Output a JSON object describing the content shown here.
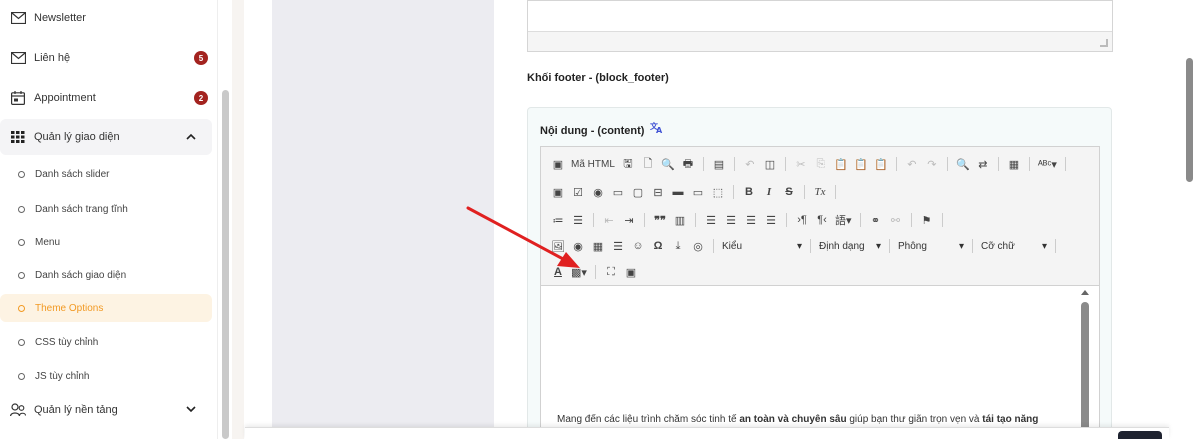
{
  "sidebar": {
    "items": [
      {
        "label": "Newsletter",
        "icon": "mail-icon"
      },
      {
        "label": "Liên hệ",
        "icon": "mail-icon",
        "badge": "5"
      },
      {
        "label": "Appointment",
        "icon": "calendar-icon",
        "badge": "2"
      },
      {
        "label": "Quản lý giao diện",
        "icon": "grid-icon"
      },
      {
        "label": "Quản lý nền tảng",
        "icon": "users-icon"
      }
    ],
    "sub_items": [
      {
        "label": "Danh sách slider"
      },
      {
        "label": "Danh sách trang tĩnh"
      },
      {
        "label": "Menu"
      },
      {
        "label": "Danh sách giao diện"
      },
      {
        "label": "Theme Options"
      },
      {
        "label": "CSS tùy chỉnh"
      },
      {
        "label": "JS tùy chỉnh"
      }
    ]
  },
  "main": {
    "section_title": "Khối footer - (block_footer)",
    "field_label": "Nội dung - (content)",
    "toolbar": {
      "source_label": "Mã HTML",
      "style_combo": "Kiểu",
      "format_combo": "Định dạng",
      "font_combo": "Phông",
      "size_combo": "Cỡ chữ",
      "bold": "B",
      "italic": "I",
      "strike": "S",
      "remove_format": "Tx"
    },
    "editor_text": {
      "part1": "Mang đến các liệu trình chăm sóc tinh tế ",
      "bold1": "an toàn và chuyên sâu",
      "part2": " giúp bạn thư giãn trọn vẹn và ",
      "bold2": "tái tạo năng"
    }
  },
  "colors": {
    "accent": "#f29a24",
    "badge": "#a3231f",
    "arrow": "#e02020",
    "translate": "#3f51d4"
  }
}
